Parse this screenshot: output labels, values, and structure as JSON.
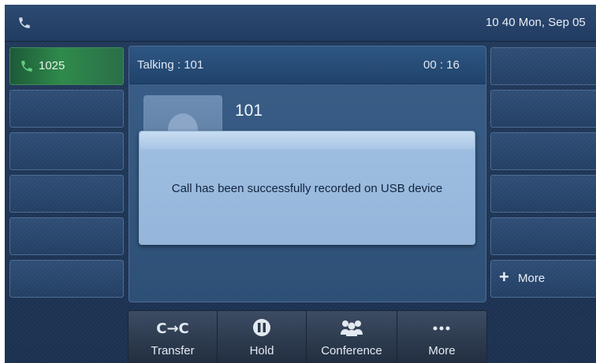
{
  "status_bar": {
    "icon": "phone-icon",
    "datetime": "10 40 Mon, Sep 05"
  },
  "line_keys": [
    {
      "label": "1025",
      "icon": "phone-icon",
      "active": true,
      "color": "#2f8a4b"
    },
    {
      "label": ""
    },
    {
      "label": ""
    },
    {
      "label": ""
    },
    {
      "label": ""
    },
    {
      "label": ""
    }
  ],
  "call": {
    "status": "Talking : 101",
    "timer": "00 : 16",
    "contact_number": "101",
    "avatar_icon": "person-silhouette-icon"
  },
  "popup": {
    "message": "Call has been successfully recorded on USB device"
  },
  "right_keys": [
    {
      "label": ""
    },
    {
      "label": ""
    },
    {
      "label": ""
    },
    {
      "label": ""
    },
    {
      "label": ""
    },
    {
      "label": "More",
      "icon": "plus-icon"
    }
  ],
  "softkeys": [
    {
      "label": "Transfer",
      "icon": "transfer-icon"
    },
    {
      "label": "Hold",
      "icon": "pause-icon"
    },
    {
      "label": "Conference",
      "icon": "conference-icon"
    },
    {
      "label": "More",
      "icon": "more-dots-icon"
    }
  ],
  "colors": {
    "background": "#1c3150",
    "active_line": "#2f8a4b",
    "popup": "#9dbde0",
    "softkey_bar": "#2c3a4e"
  }
}
